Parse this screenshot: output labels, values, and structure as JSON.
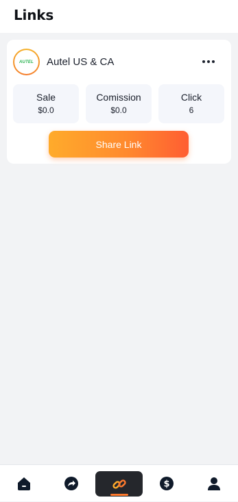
{
  "header": {
    "title": "Links"
  },
  "card": {
    "logo_text": "AUTEL",
    "brand_name": "Autel US & CA",
    "stats": [
      {
        "label": "Sale",
        "value": "$0.0"
      },
      {
        "label": "Comission",
        "value": "$0.0"
      },
      {
        "label": "Click",
        "value": "6"
      }
    ],
    "share_button": "Share Link"
  },
  "tabbar": {
    "items": [
      {
        "name": "home",
        "icon": "home-icon"
      },
      {
        "name": "share",
        "icon": "share-arrow-icon"
      },
      {
        "name": "links",
        "icon": "link-icon",
        "active": true
      },
      {
        "name": "earnings",
        "icon": "dollar-icon"
      },
      {
        "name": "profile",
        "icon": "user-icon"
      }
    ],
    "accent_color": "#ff7a2e"
  }
}
